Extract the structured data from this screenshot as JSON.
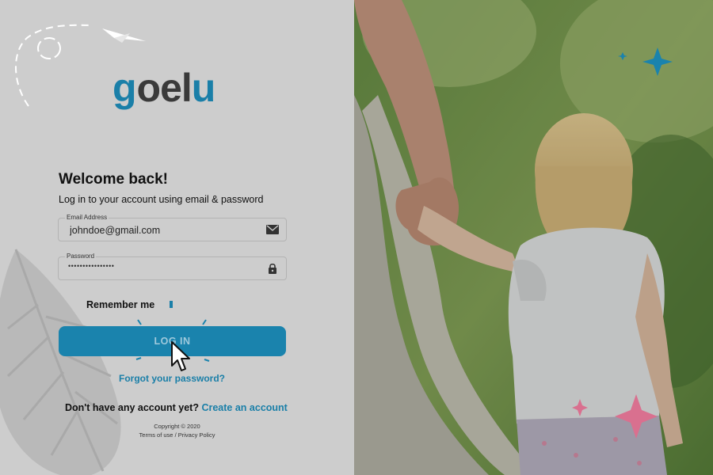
{
  "brand": {
    "logo_text_g": "g",
    "logo_text_mid": "oel",
    "logo_text_u": "u",
    "primary_color": "#1a7fa8",
    "dark_color": "#3a3a3a"
  },
  "login": {
    "heading": "Welcome back!",
    "subtitle": "Log in to your account using email & password",
    "email": {
      "label": "Email Address",
      "value": "johndoe@gmail.com",
      "icon": "envelope-icon"
    },
    "password": {
      "label": "Password",
      "masked_value": "••••••••••••••••",
      "icon": "lock-icon"
    },
    "remember_label": "Remember me",
    "submit_label": "LOG IN",
    "forgot_label": "Forgot your password?",
    "no_account_text": "Don't have any account yet?",
    "create_label": "Create an account"
  },
  "footer": {
    "copyright": "Copyright © 2020",
    "terms": "Terms of use",
    "separator": "/",
    "privacy": "Privacy Policy"
  },
  "colors": {
    "accent_blue": "#1a83ad",
    "accent_pink": "#d9708f",
    "panel_bg": "#cdcdcd"
  }
}
